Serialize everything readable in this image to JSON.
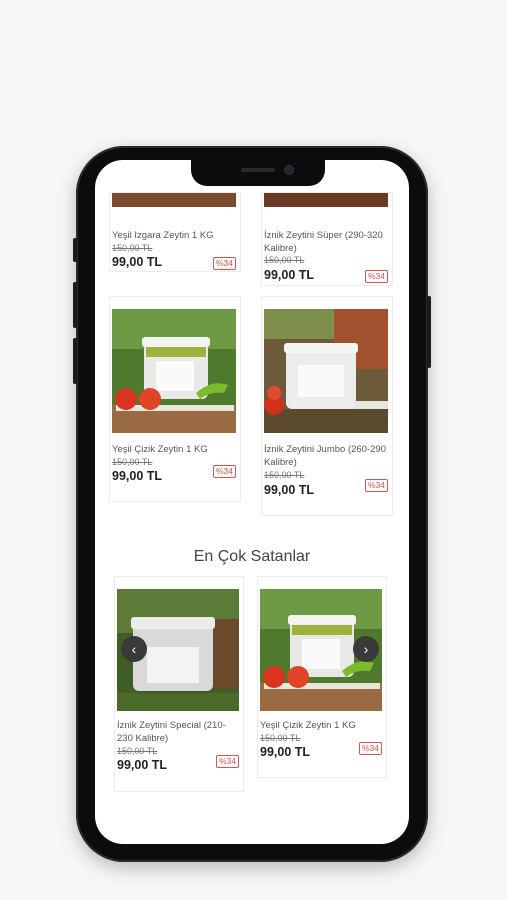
{
  "top_grid": [
    {
      "name": "Yeşil Izgara Zeytin 1 KG",
      "old_price": "150,00 TL",
      "price": "99,00 TL",
      "discount": "%34"
    },
    {
      "name": "İznik Zeytini Süper (290-320 Kalibre)",
      "old_price": "150,00 TL",
      "price": "99,00 TL",
      "discount": "%34"
    },
    {
      "name": "Yeşil Çizik Zeytin 1 KG",
      "old_price": "150,00 TL",
      "price": "99,00 TL",
      "discount": "%34"
    },
    {
      "name": "İznik Zeytini Jumbo (260-290 Kalibre)",
      "old_price": "150,00 TL",
      "price": "99,00 TL",
      "discount": "%34"
    }
  ],
  "best_sellers": {
    "title": "En Çok Satanlar",
    "items": [
      {
        "name": "İznik Zeytini Special (210-230 Kalibre)",
        "old_price": "150,00 TL",
        "price": "99,00 TL",
        "discount": "%34"
      },
      {
        "name": "Yeşil Çizik Zeytin 1 KG",
        "old_price": "150,00 TL",
        "price": "99,00 TL",
        "discount": "%34"
      }
    ],
    "prev_icon": "chevron-left-icon",
    "next_icon": "chevron-right-icon"
  },
  "colors": {
    "discount": "#d9534f",
    "background": "#f7f7f7",
    "phone": "#0c0c0c"
  }
}
